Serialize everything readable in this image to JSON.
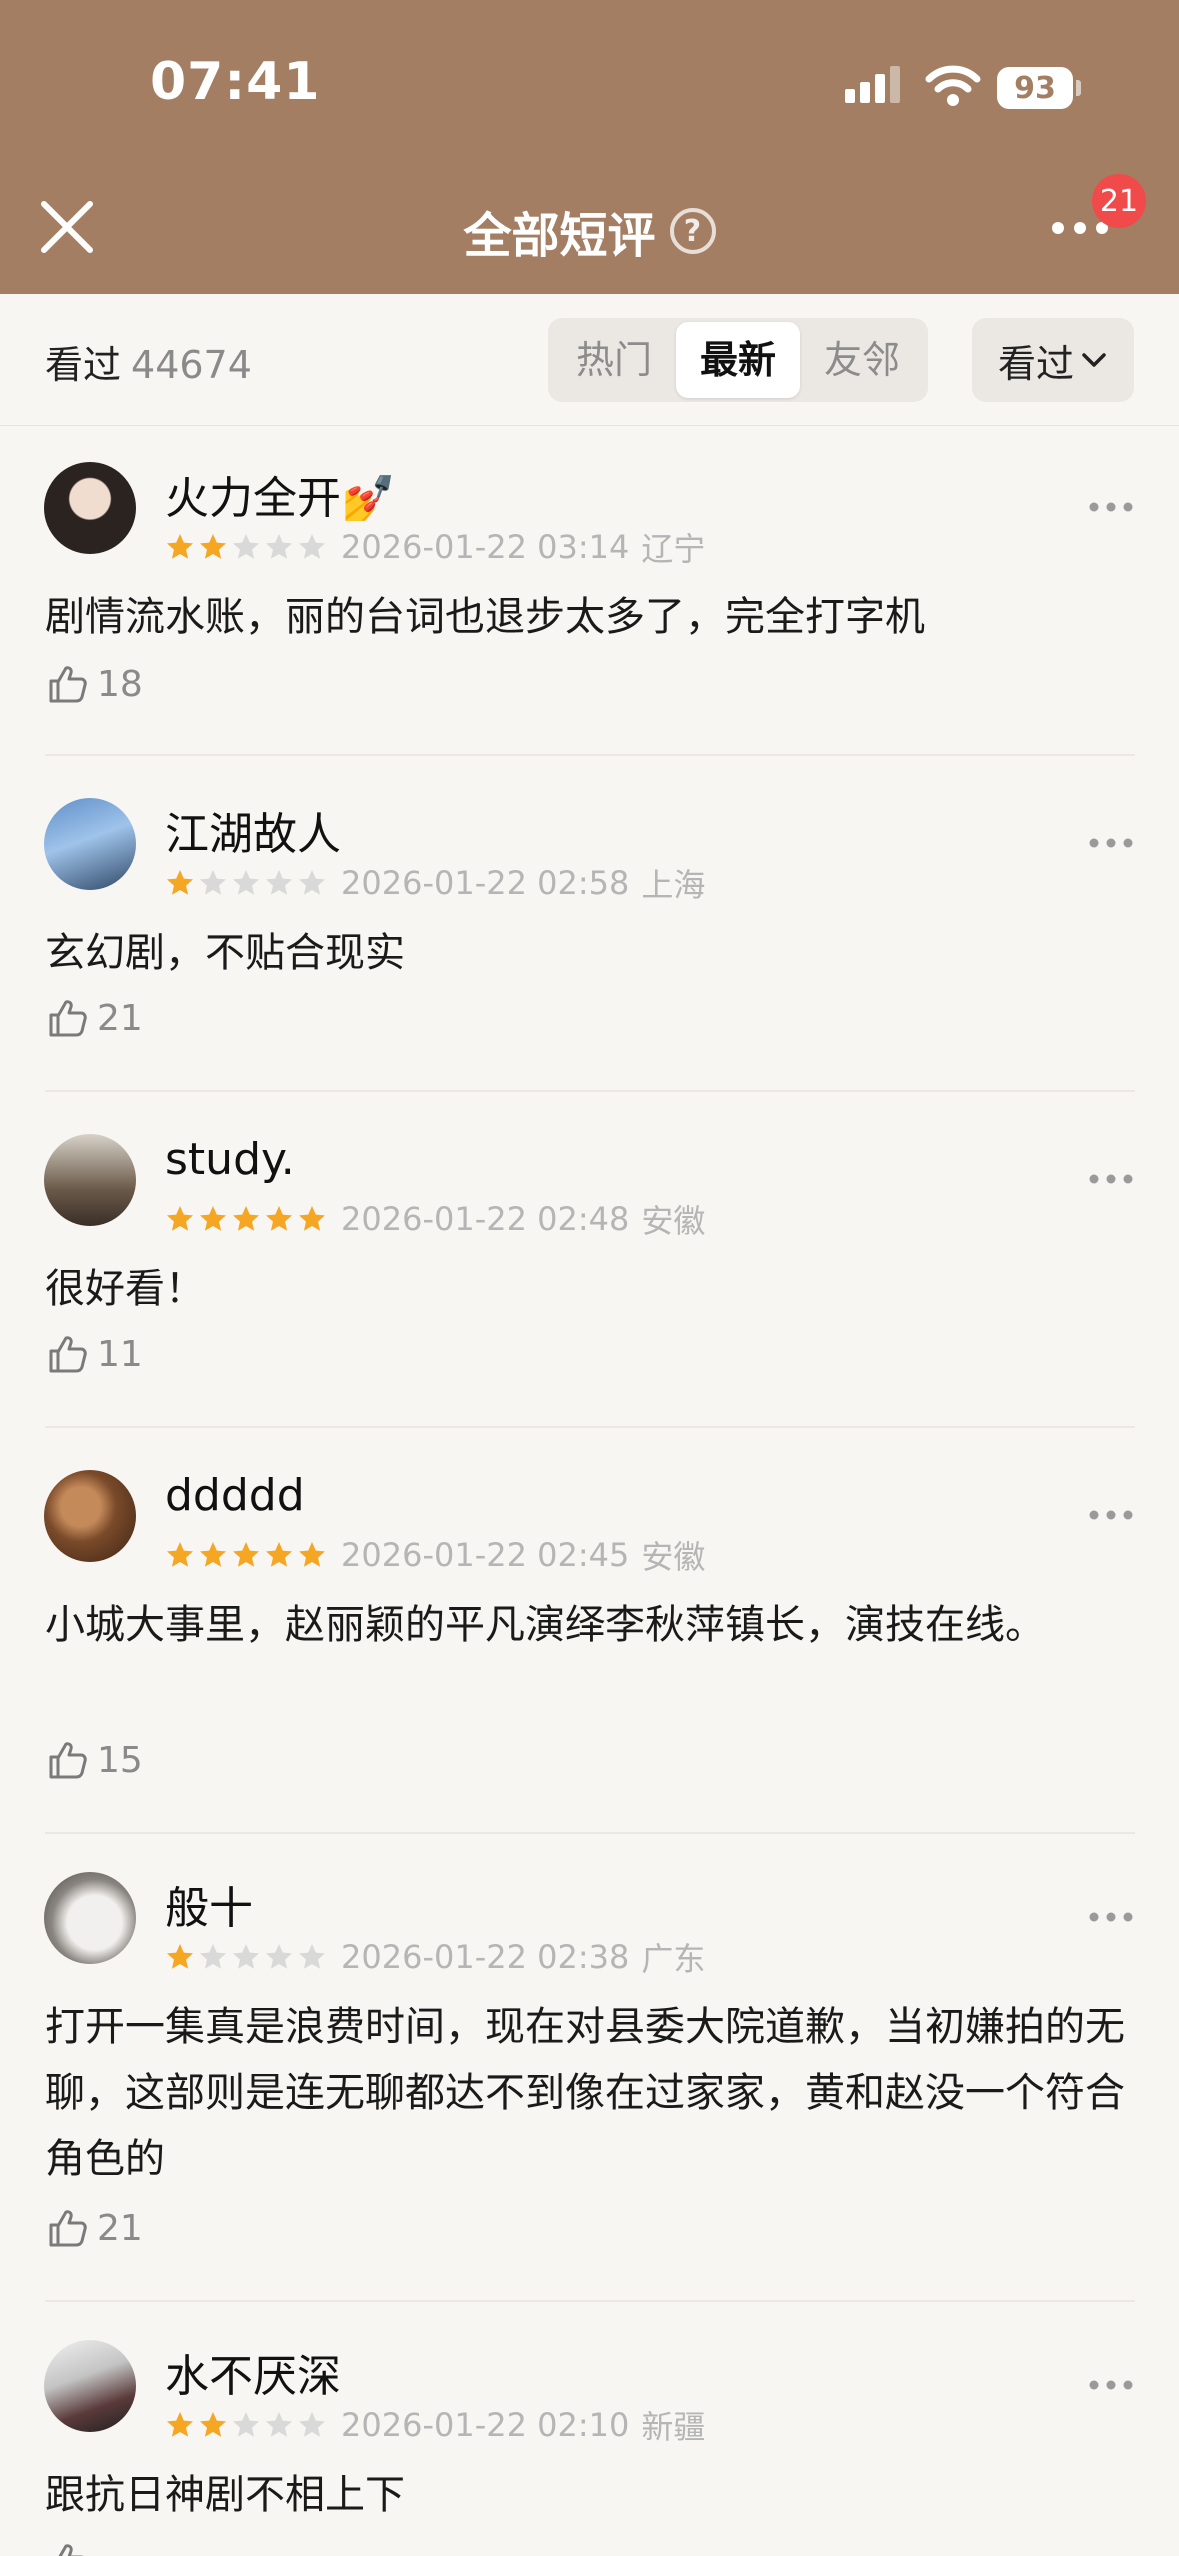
{
  "status": {
    "time": "07:41",
    "battery": "93"
  },
  "nav": {
    "title": "全部短评",
    "help": "?",
    "badge": "21"
  },
  "filter": {
    "watched_label": "看过",
    "watched_count": "44674",
    "tabs": [
      "热门",
      "最新",
      "友邻"
    ],
    "active_tab": "最新",
    "dropdown_label": "看过"
  },
  "colors": {
    "header": "#a37e63",
    "star": "#f5a623",
    "star_empty": "#d9d9d9",
    "badge": "#f04a4a"
  },
  "comments": [
    {
      "user": "火力全开💅",
      "rating": 2,
      "time": "2026-01-22 03:14",
      "location": "辽宁",
      "text": "剧情流水账，丽的台词也退步太多了，完全打字机",
      "likes": "18"
    },
    {
      "user": "江湖故人",
      "rating": 1,
      "time": "2026-01-22 02:58",
      "location": "上海",
      "text": "玄幻剧，不贴合现实",
      "likes": "21"
    },
    {
      "user": "study.",
      "rating": 5,
      "time": "2026-01-22 02:48",
      "location": "安徽",
      "text": "很好看！",
      "likes": "11"
    },
    {
      "user": "ddddd",
      "rating": 5,
      "time": "2026-01-22 02:45",
      "location": "安徽",
      "text": "小城大事里，赵丽颖的平凡演绎李秋萍镇长，演技在线。",
      "likes": "15"
    },
    {
      "user": "般十",
      "rating": 1,
      "time": "2026-01-22 02:38",
      "location": "广东",
      "text": "打开一集真是浪费时间，现在对县委大院道歉，当初嫌拍的无聊，这部则是连无聊都达不到像在过家家，黄和赵没一个符合角色的",
      "likes": "21"
    },
    {
      "user": "水不厌深",
      "rating": 2,
      "time": "2026-01-22 02:10",
      "location": "新疆",
      "text": "跟抗日神剧不相上下",
      "likes": ""
    }
  ]
}
